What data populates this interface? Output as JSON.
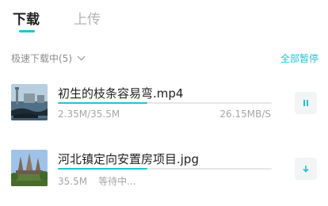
{
  "tabs": [
    {
      "label": "下载",
      "active": true
    },
    {
      "label": "上传",
      "active": false
    }
  ],
  "section": {
    "title": "极速下载中(5)",
    "pause_all": "全部暂停"
  },
  "downloads": [
    {
      "name": "初生的枝条容易弯.mp4",
      "progress_text": "2.35M/35.5M",
      "speed": "26.15MB/S",
      "progress": 0.42,
      "action_icon": "pause-icon"
    },
    {
      "name": "河北镇定向安置房项目.jpg",
      "size_text": "35.5M",
      "status": "等待中...",
      "progress": 0.42,
      "action_icon": "download-icon"
    }
  ],
  "colors": {
    "accent": "#22c3d2",
    "muted": "#a6a6a6",
    "text": "#1f1f1f"
  }
}
